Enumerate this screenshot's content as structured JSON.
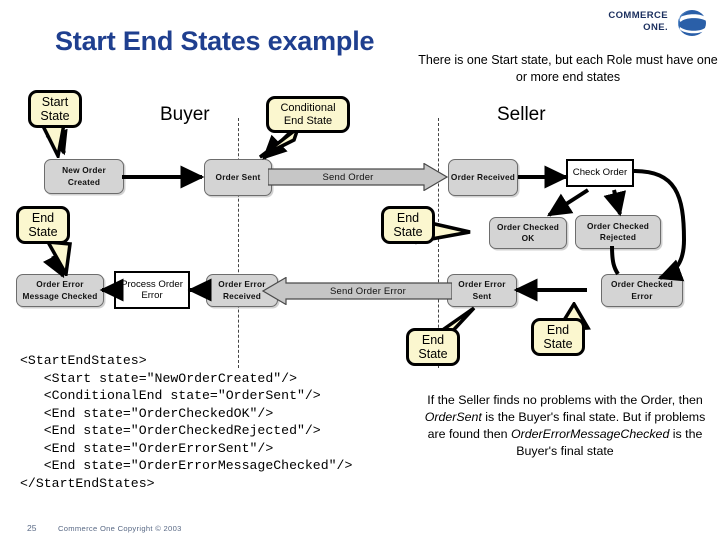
{
  "slide": {
    "title": "Start End States example",
    "header_note": "There is one Start state, but each Role must have one or more end states",
    "logo": {
      "line1": "COMMERCE",
      "line2": "ONE.",
      "mark_name": "commerce-one-globe-icon",
      "color": "#1b2f5e"
    },
    "footer": {
      "page_number": "25",
      "copyright": "Commerce One Copyright © 2003"
    }
  },
  "lanes": [
    {
      "label": "Buyer"
    },
    {
      "label": "Seller"
    }
  ],
  "states": [
    {
      "id": "new-order-created",
      "label": "New Order Created"
    },
    {
      "id": "order-sent",
      "label": "Order Sent"
    },
    {
      "id": "order-received",
      "label": "Order Received"
    },
    {
      "id": "order-checked-ok",
      "label": "Order Checked OK"
    },
    {
      "id": "order-checked-rejected",
      "label": "Order Checked Rejected"
    },
    {
      "id": "order-error-message-checked",
      "label": "Order Error Message Checked"
    },
    {
      "id": "order-error-received",
      "label": "Order Error Received"
    },
    {
      "id": "order-error-sent",
      "label": "Order Error Sent"
    },
    {
      "id": "order-checked-error",
      "label": "Order Checked Error"
    }
  ],
  "processes": [
    {
      "id": "check-order",
      "label": "Check Order"
    },
    {
      "id": "process-order-error",
      "label": "Process Order Error"
    }
  ],
  "messages": [
    {
      "id": "send-order",
      "label": "Send Order",
      "direction": "right"
    },
    {
      "id": "send-order-error",
      "label": "Send Order Error",
      "direction": "left"
    }
  ],
  "callouts": [
    {
      "id": "start-state",
      "line1": "Start",
      "line2": "State"
    },
    {
      "id": "conditional-end-state",
      "line1": "Conditional",
      "line2": "End State"
    },
    {
      "id": "end-state-buyer",
      "line1": "End",
      "line2": "State"
    },
    {
      "id": "end-state-seller",
      "line1": "End",
      "line2": "State"
    },
    {
      "id": "end-state-error-sent",
      "line1": "End",
      "line2": "State"
    },
    {
      "id": "end-state-checked-err",
      "line1": "End",
      "line2": "State"
    }
  ],
  "code": {
    "lines": [
      "<StartEndStates>",
      "   <Start state=\"NewOrderCreated\"/>",
      "   <ConditionalEnd state=\"OrderSent\"/>",
      "   <End state=\"OrderCheckedOK\"/>",
      "   <End state=\"OrderCheckedRejected\"/>",
      "   <End state=\"OrderErrorSent\"/>",
      "   <End state=\"OrderErrorMessageChecked\"/>",
      "</StartEndStates>"
    ],
    "text": "<StartEndStates>\n   <Start state=\"NewOrderCreated\"/>\n   <ConditionalEnd state=\"OrderSent\"/>\n   <End state=\"OrderCheckedOK\"/>\n   <End state=\"OrderCheckedRejected\"/>\n   <End state=\"OrderErrorSent\"/>\n   <End state=\"OrderErrorMessageChecked\"/>\n</StartEndStates>"
  },
  "explanation": {
    "part1": "If the Seller finds no problems with the Order, then ",
    "em1": "OrderSent",
    "part2": " is the Buyer's final state. But if problems are found then ",
    "em2": "OrderErrorMessageChecked",
    "part3": " is the Buyer's final state"
  },
  "colors": {
    "title": "#1f3f8f",
    "state_fill": "#d4d4d4",
    "callout_fill": "#fbf7cf",
    "message_fill": "#c6c6c6",
    "footer": "#5a6a86"
  }
}
